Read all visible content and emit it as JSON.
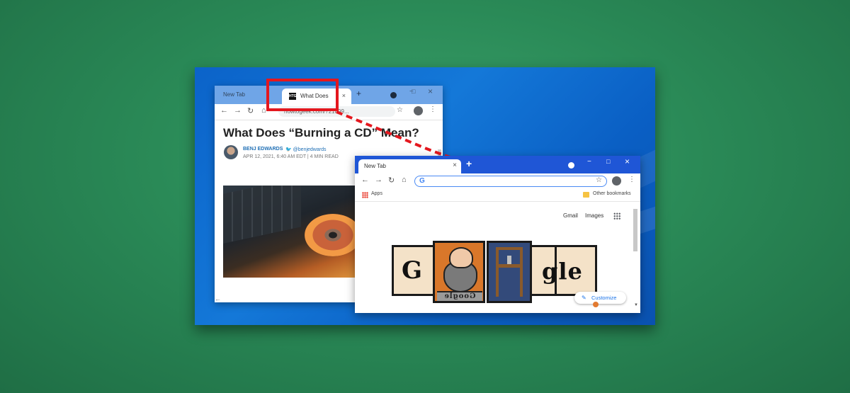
{
  "window_article": {
    "tabs": [
      {
        "label": "New Tab"
      },
      {
        "label": "What Does",
        "favicon": "HTG"
      }
    ],
    "new_tab_symbol": "+",
    "address": "howtogeek.com/721899...",
    "article": {
      "title": "What Does “Burning a CD” Mean?",
      "author": "BENJ EDWARDS",
      "twitter": "@benjedwards",
      "meta": "APR 12, 2021, 6:40 AM EDT | 4 MIN READ"
    }
  },
  "window_newtab": {
    "tab_label": "New Tab",
    "new_tab_symbol": "+",
    "omnibox_logo": "G",
    "bookmarks": {
      "apps_label": "Apps",
      "other_label": "Other bookmarks"
    },
    "top_links": {
      "gmail": "Gmail",
      "images": "Images"
    },
    "doodle": {
      "left_letter": "G",
      "right_letters": "gle",
      "type_block": "Google"
    },
    "customize_label": "Customize"
  },
  "icons": {
    "close": "×",
    "minimize": "−",
    "maximize": "□",
    "back": "←",
    "forward": "→",
    "reload": "↻",
    "home": "⌂",
    "star": "☆",
    "kebab": "⋮",
    "pen": "✎"
  },
  "colors": {
    "highlight": "#e4171e",
    "chrome_blue": "#1f56d6",
    "link_blue": "#1a73e8"
  }
}
